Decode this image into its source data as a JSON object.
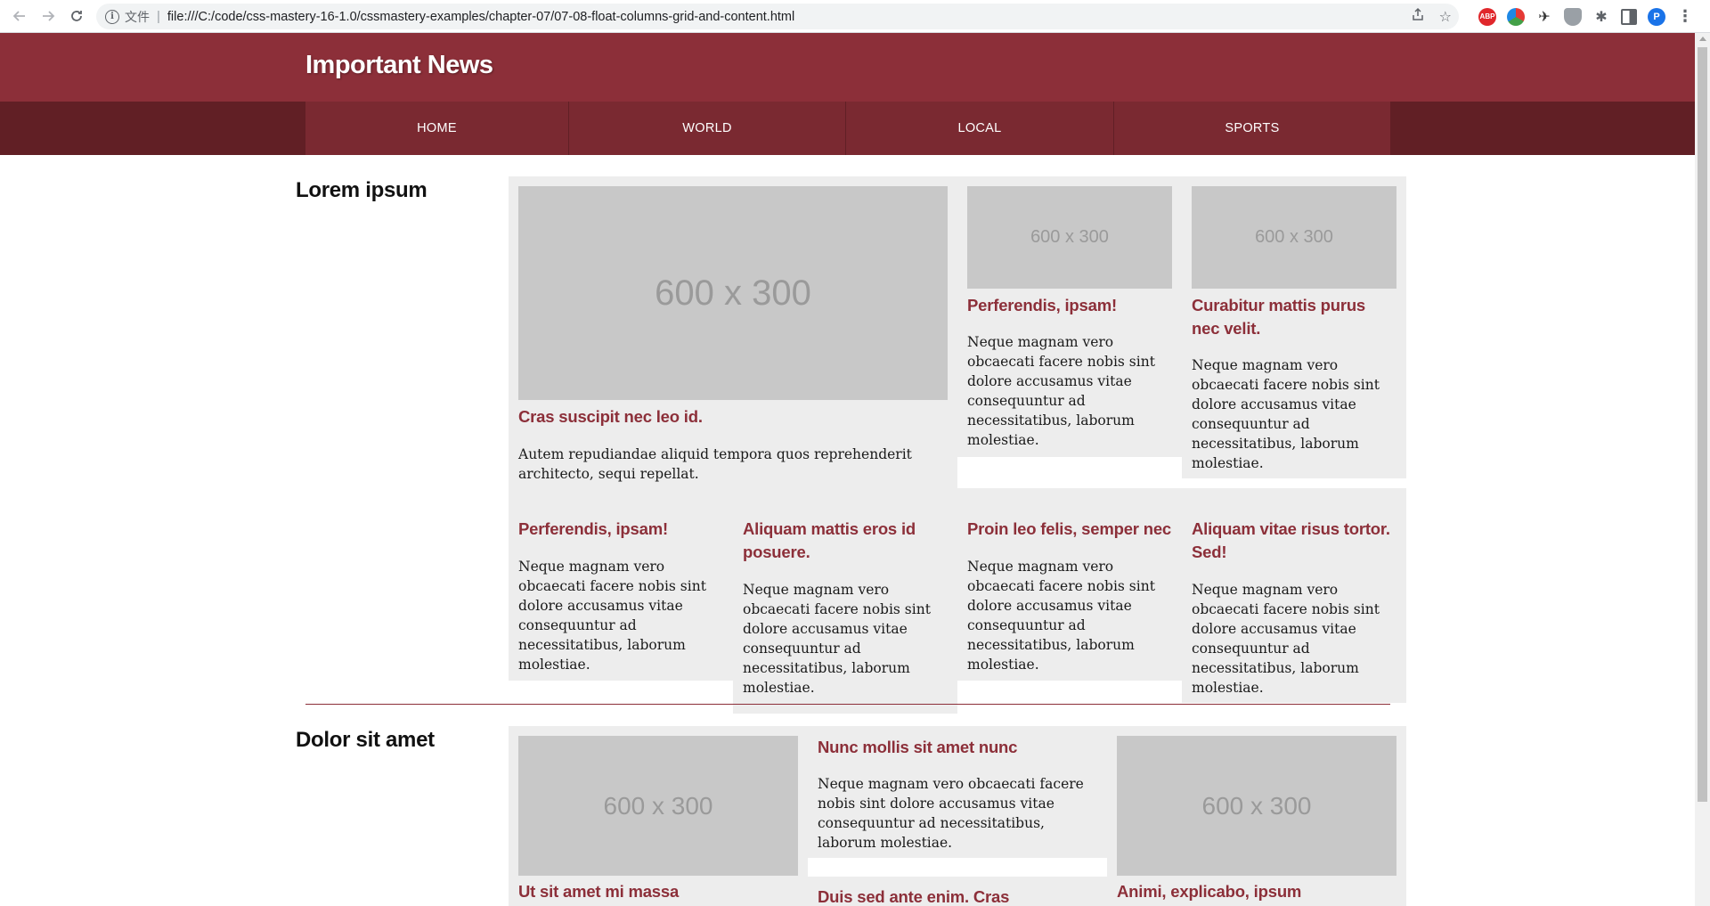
{
  "browser": {
    "protocol_label": "文件",
    "url": "file:///C:/code/css-mastery-16-1.0/cssmastery-examples/chapter-07/07-08-float-columns-grid-and-content.html",
    "profile_initial": "P",
    "ext_abp_label": "ABP"
  },
  "site": {
    "title": "Important News"
  },
  "nav": [
    "HOME",
    "WORLD",
    "LOCAL",
    "SPORTS"
  ],
  "sections": [
    {
      "title": "Lorem ipsum",
      "featured": {
        "image": "600 x 300",
        "headline": "Cras suscipit nec leo id.",
        "text": "Autem repudiandae aliquid tempora quos reprehenderit architecto, sequi repellat."
      },
      "top_right": [
        {
          "image": "600 x 300",
          "headline": "Perferendis, ipsam!",
          "text": "Neque magnam vero obcaecati facere nobis sint dolore accusamus vitae consequuntur ad necessitatibus, laborum molestiae."
        },
        {
          "image": "600 x 300",
          "headline": "Curabitur mattis purus nec velit.",
          "text": "Neque magnam vero obcaecati facere nobis sint dolore accusamus vitae consequuntur ad necessitatibus, laborum molestiae."
        }
      ],
      "bottom_row": [
        {
          "headline": "Perferendis, ipsam!",
          "text": "Neque magnam vero obcaecati facere nobis sint dolore accusamus vitae consequuntur ad necessitatibus, laborum molestiae."
        },
        {
          "headline": "Aliquam mattis eros id posuere.",
          "text": "Neque magnam vero obcaecati facere nobis sint dolore accusamus vitae consequuntur ad necessitatibus, laborum molestiae."
        },
        {
          "headline": "Proin leo felis, semper nec",
          "text": "Neque magnam vero obcaecati facere nobis sint dolore accusamus vitae consequuntur ad necessitatibus, laborum molestiae."
        },
        {
          "headline": "Aliquam vitae risus tortor. Sed!",
          "text": "Neque magnam vero obcaecati facere nobis sint dolore accusamus vitae consequuntur ad necessitatibus, laborum molestiae."
        }
      ]
    },
    {
      "title": "Dolor sit amet",
      "columns": [
        {
          "image": "600 x 300",
          "headline": "Ut sit amet mi massa"
        },
        {
          "headline": "Nunc mollis sit amet nunc",
          "text": "Neque magnam vero obcaecati facere nobis sint dolore accusamus vitae consequuntur ad necessitatibus, laborum molestiae.",
          "headline2": "Duis sed ante enim. Cras"
        },
        {
          "image": "600 x 300",
          "headline": "Animi, explicabo, ipsum"
        }
      ]
    }
  ],
  "colors": {
    "brand": "#8c2f39",
    "nav_dark": "#611f25",
    "nav_item": "#7a2931",
    "box_bg": "#ededed",
    "placeholder": "#c8c8c8"
  }
}
